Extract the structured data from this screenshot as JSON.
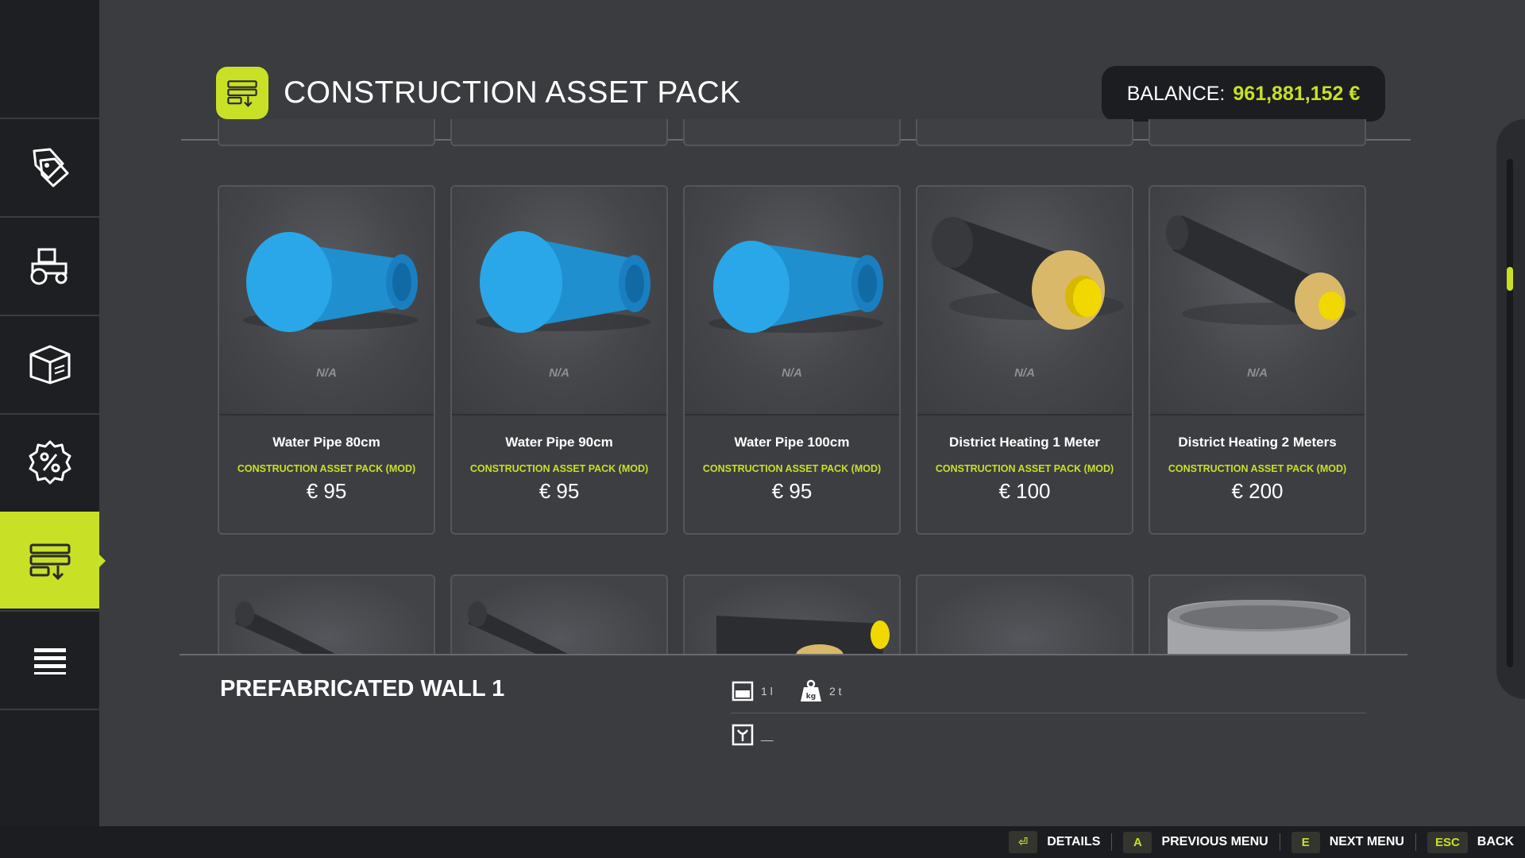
{
  "header": {
    "title": "CONSTRUCTION ASSET PACK",
    "balance_label": "BALANCE:",
    "balance_value": "961,881,152 €"
  },
  "sidebar": {
    "items": [
      {
        "name": "shop-tags",
        "icon": "price-tags-icon"
      },
      {
        "name": "vehicles",
        "icon": "tractor-icon"
      },
      {
        "name": "objects",
        "icon": "box-icon"
      },
      {
        "name": "sales",
        "icon": "percent-icon"
      },
      {
        "name": "construction",
        "icon": "construction-pack-icon",
        "active": true
      },
      {
        "name": "menu",
        "icon": "list-icon"
      }
    ]
  },
  "products": [
    {
      "name": "Water Pipe 80cm",
      "pack": "CONSTRUCTION ASSET PACK (MOD)",
      "price": "€ 95",
      "availability": "N/A",
      "art": "blue-pipe"
    },
    {
      "name": "Water Pipe 90cm",
      "pack": "CONSTRUCTION ASSET PACK (MOD)",
      "price": "€ 95",
      "availability": "N/A",
      "art": "blue-pipe"
    },
    {
      "name": "Water Pipe 100cm",
      "pack": "CONSTRUCTION ASSET PACK (MOD)",
      "price": "€ 95",
      "availability": "N/A",
      "art": "blue-pipe"
    },
    {
      "name": "District Heating 1 Meter",
      "pack": "CONSTRUCTION ASSET PACK (MOD)",
      "price": "€ 100",
      "availability": "N/A",
      "art": "heating-pipe-large"
    },
    {
      "name": "District Heating 2 Meters",
      "pack": "CONSTRUCTION ASSET PACK (MOD)",
      "price": "€ 200",
      "availability": "N/A",
      "art": "heating-pipe-small"
    }
  ],
  "details": {
    "title": "PREFABRICATED WALL 1",
    "capacity": "1 l",
    "weight": "2 t",
    "fill_type": "__"
  },
  "footer": {
    "buttons": [
      {
        "key": "⏎",
        "label": "DETAILS"
      },
      {
        "key": "A",
        "label": "PREVIOUS MENU"
      },
      {
        "key": "E",
        "label": "NEXT MENU"
      },
      {
        "key": "ESC",
        "label": "BACK"
      }
    ]
  },
  "colors": {
    "accent": "#c8e026",
    "background": "#3b3c40",
    "sidebar": "#1e1f22",
    "pipe_blue": "#2aa7e8",
    "insulation": "#d9b86a",
    "core_yellow": "#f0d800"
  }
}
